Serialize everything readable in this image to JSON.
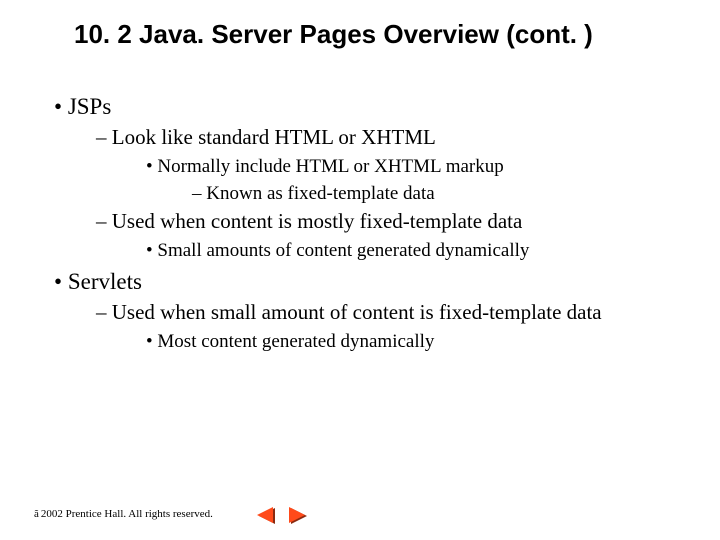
{
  "title": "10. 2   Java. Server Pages Overview (cont. )",
  "bullets": {
    "b1": "JSPs",
    "b1_1": "Look like standard HTML or XHTML",
    "b1_1_1": "Normally include HTML or XHTML markup",
    "b1_1_1_1": "Known as fixed-template data",
    "b1_2": "Used when content is mostly fixed-template data",
    "b1_2_1": "Small amounts of content generated dynamically",
    "b2": "Servlets",
    "b2_1": "Used when small amount of content is fixed-template data",
    "b2_1_1": "Most content generated dynamically"
  },
  "footer": {
    "copyright_symbol": "ã",
    "text": " 2002 Prentice Hall. All rights reserved."
  },
  "nav": {
    "prev": "previous-slide",
    "next": "next-slide"
  },
  "colors": {
    "nav_fill": "#ff4a1a",
    "nav_shadow": "#8a2a10"
  }
}
